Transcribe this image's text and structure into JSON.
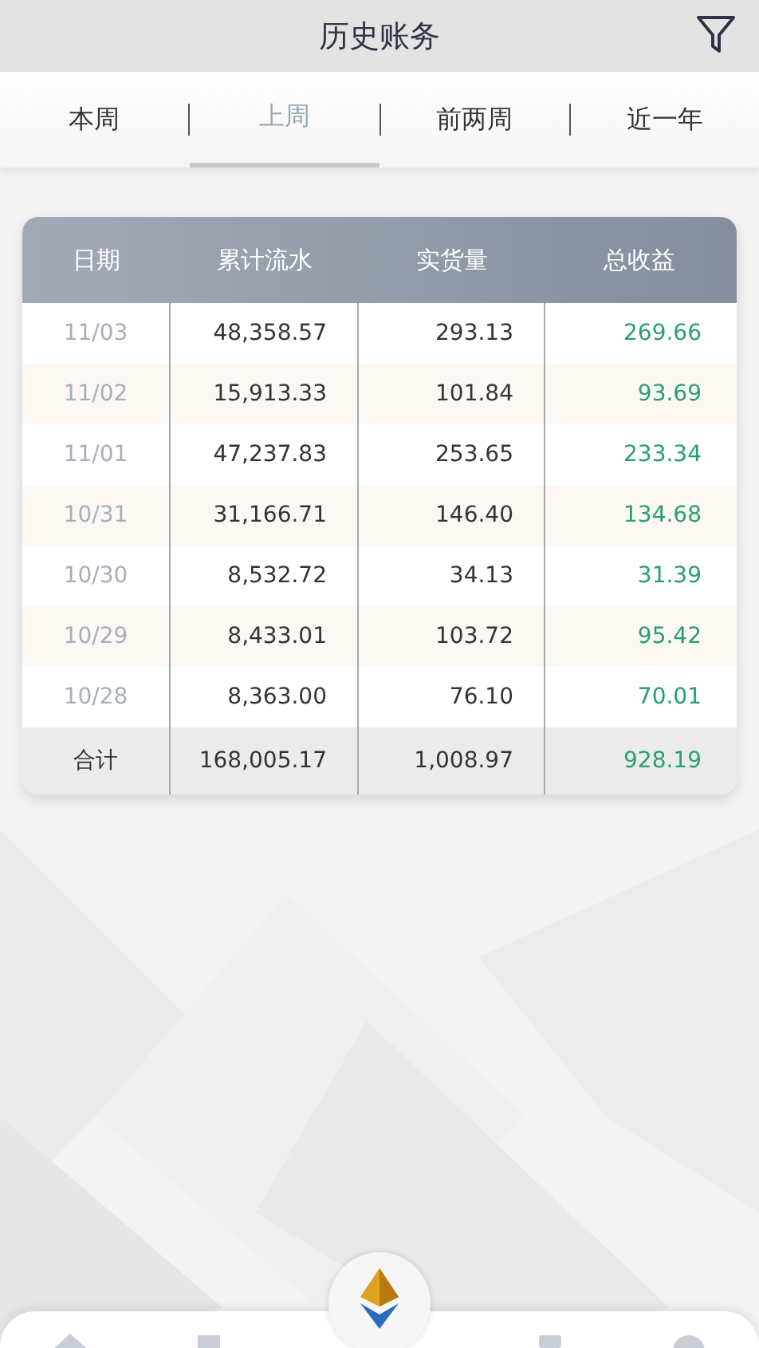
{
  "header": {
    "title": "历史账务"
  },
  "tabs": [
    {
      "label": "本周",
      "selected": false
    },
    {
      "label": "上周",
      "selected": true
    },
    {
      "label": "前两周",
      "selected": false
    },
    {
      "label": "近一年",
      "selected": false
    }
  ],
  "table": {
    "columns": [
      "日期",
      "累计流水",
      "实货量",
      "总收益"
    ],
    "rows": [
      [
        "11/03",
        "48,358.57",
        "293.13",
        "269.66"
      ],
      [
        "11/02",
        "15,913.33",
        "101.84",
        "93.69"
      ],
      [
        "11/01",
        "47,237.83",
        "253.65",
        "233.34"
      ],
      [
        "10/31",
        "31,166.71",
        "146.40",
        "134.68"
      ],
      [
        "10/30",
        "8,532.72",
        "34.13",
        "31.39"
      ],
      [
        "10/29",
        "8,433.01",
        "103.72",
        "95.42"
      ],
      [
        "10/28",
        "8,363.00",
        "76.10",
        "70.01"
      ]
    ],
    "total": [
      "合计",
      "168,005.17",
      "1,008.97",
      "928.19"
    ]
  }
}
